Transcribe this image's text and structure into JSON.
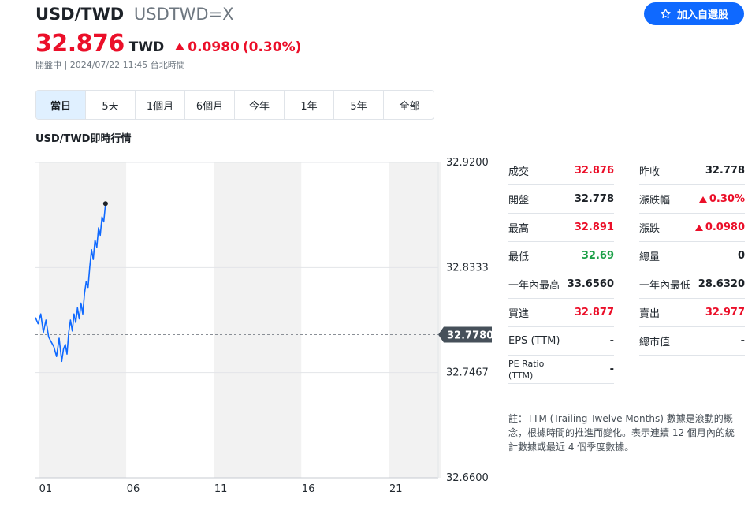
{
  "header": {
    "pair": "USD/TWD",
    "ticker": "USDTWD=X",
    "follow_label": "加入自選股",
    "follow_icon": "star-outline-icon",
    "price": "32.876",
    "currency": "TWD",
    "change": "0.0980",
    "change_pct": "(0.30%)",
    "status": "開盤中 | 2024/07/22 11:45 台北時間",
    "accent_color": "#0f69ff",
    "up_color": "#eb0f29",
    "down_color": "#1a9f46"
  },
  "range_tabs": [
    {
      "label": "當日",
      "active": true
    },
    {
      "label": "5天",
      "active": false
    },
    {
      "label": "1個月",
      "active": false
    },
    {
      "label": "6個月",
      "active": false
    },
    {
      "label": "今年",
      "active": false
    },
    {
      "label": "1年",
      "active": false
    },
    {
      "label": "5年",
      "active": false
    },
    {
      "label": "全部",
      "active": false
    }
  ],
  "chart_title": "USD/TWD即時行情",
  "chart_data": {
    "type": "line",
    "title": "USD/TWD即時行情",
    "y_ticks": [
      "32.9200",
      "32.8333",
      "32.7467",
      "32.6600"
    ],
    "x_ticks": [
      "01",
      "06",
      "11",
      "16",
      "21"
    ],
    "ylim": [
      32.66,
      32.92
    ],
    "xlim": [
      0,
      23
    ],
    "reference_line": {
      "value": 32.778,
      "label": "32.7780",
      "style": "dashed"
    },
    "grid": true,
    "series": [
      {
        "color": "#0f69ff",
        "x": [
          0.0,
          0.15,
          0.3,
          0.45,
          0.6,
          0.75,
          0.9,
          1.05,
          1.2,
          1.35,
          1.5,
          1.6,
          1.7,
          1.8,
          1.9,
          2.0,
          2.1,
          2.2,
          2.3,
          2.4,
          2.5,
          2.6,
          2.7,
          2.8,
          2.9,
          3.0,
          3.1,
          3.2,
          3.3,
          3.4,
          3.5,
          3.6,
          3.7,
          3.8,
          3.9,
          4.0
        ],
        "values": [
          32.792,
          32.787,
          32.795,
          32.78,
          32.79,
          32.776,
          32.772,
          32.768,
          32.76,
          32.775,
          32.756,
          32.766,
          32.77,
          32.762,
          32.78,
          32.79,
          32.781,
          32.795,
          32.788,
          32.8,
          32.791,
          32.804,
          32.795,
          32.812,
          32.822,
          32.817,
          32.834,
          32.848,
          32.84,
          32.856,
          32.85,
          32.866,
          32.86,
          32.875,
          32.871,
          32.886
        ]
      }
    ],
    "last_point": {
      "x": 4.0,
      "value": 32.886
    }
  },
  "stats_left": [
    {
      "label": "成交",
      "value": "32.876",
      "tone": "up"
    },
    {
      "label": "開盤",
      "value": "32.778",
      "tone": "neutral"
    },
    {
      "label": "最高",
      "value": "32.891",
      "tone": "up"
    },
    {
      "label": "最低",
      "value": "32.69",
      "tone": "down"
    },
    {
      "label": "一年內最高",
      "value": "33.6560",
      "tone": "neutral"
    },
    {
      "label": "買進",
      "value": "32.877",
      "tone": "up"
    },
    {
      "label": "EPS (TTM)",
      "value": "-",
      "tone": "neutral"
    },
    {
      "label": "PE Ratio (TTM)",
      "value": "-",
      "tone": "neutral"
    }
  ],
  "stats_right": [
    {
      "label": "昨收",
      "value": "32.778",
      "tone": "neutral"
    },
    {
      "label": "漲跌幅",
      "value": "0.30%",
      "tone": "up-arrow"
    },
    {
      "label": "漲跌",
      "value": "0.0980",
      "tone": "up-arrow"
    },
    {
      "label": "總量",
      "value": "0",
      "tone": "neutral"
    },
    {
      "label": "一年內最低",
      "value": "28.6320",
      "tone": "neutral"
    },
    {
      "label": "賣出",
      "value": "32.977",
      "tone": "up"
    },
    {
      "label": "總市值",
      "value": "-",
      "tone": "neutral"
    }
  ],
  "note": "註：TTM (Trailing Twelve Months) 數據是滾動的概念，根據時間的推進而變化。表示連續 12 個月內的統計數據或最近 4 個季度數據。"
}
